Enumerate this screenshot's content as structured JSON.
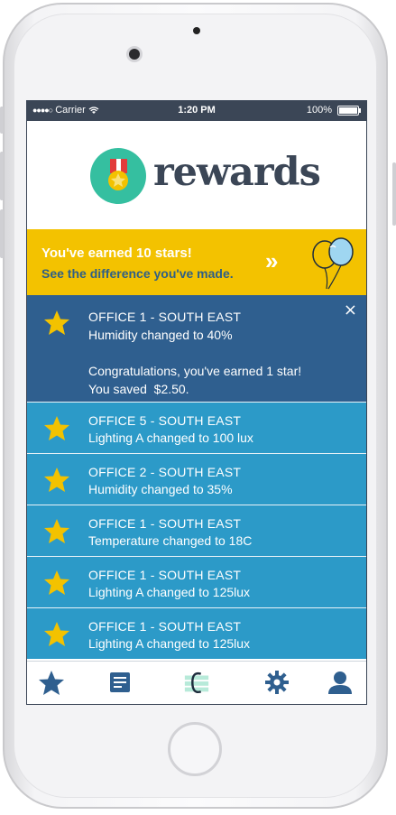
{
  "status": {
    "carrier": "Carrier",
    "time": "1:20 PM",
    "battery": "100%"
  },
  "app": {
    "brand": "rewards",
    "accent": "#35bfa0",
    "primary": "#3b4656"
  },
  "banner": {
    "line1": "You've earned 10 stars!",
    "line2": "See the difference you've made.",
    "chevrons": "»"
  },
  "notifications": [
    {
      "title": "OFFICE 1 - SOUTH EAST",
      "detail": "Humidity changed to 40%",
      "message1": "Congratulations, you've earned 1 star!",
      "message2": "You saved  $2.50.",
      "expanded": true
    },
    {
      "title": "OFFICE 5 - SOUTH EAST",
      "detail": "Lighting A changed to 100 lux"
    },
    {
      "title": "OFFICE 2 - SOUTH EAST",
      "detail": "Humidity changed to 35%"
    },
    {
      "title": "OFFICE 1 - SOUTH EAST",
      "detail": "Temperature changed to 18C"
    },
    {
      "title": "OFFICE 1 - SOUTH EAST",
      "detail": "Lighting A changed to 125lux"
    },
    {
      "title": "OFFICE 1 - SOUTH EAST",
      "detail": "Lighting A changed to 125lux"
    }
  ],
  "icons": {
    "close": "×",
    "tabs": [
      "star-icon",
      "notes-icon",
      "c-logo-icon",
      "gear-icon",
      "person-icon"
    ]
  }
}
